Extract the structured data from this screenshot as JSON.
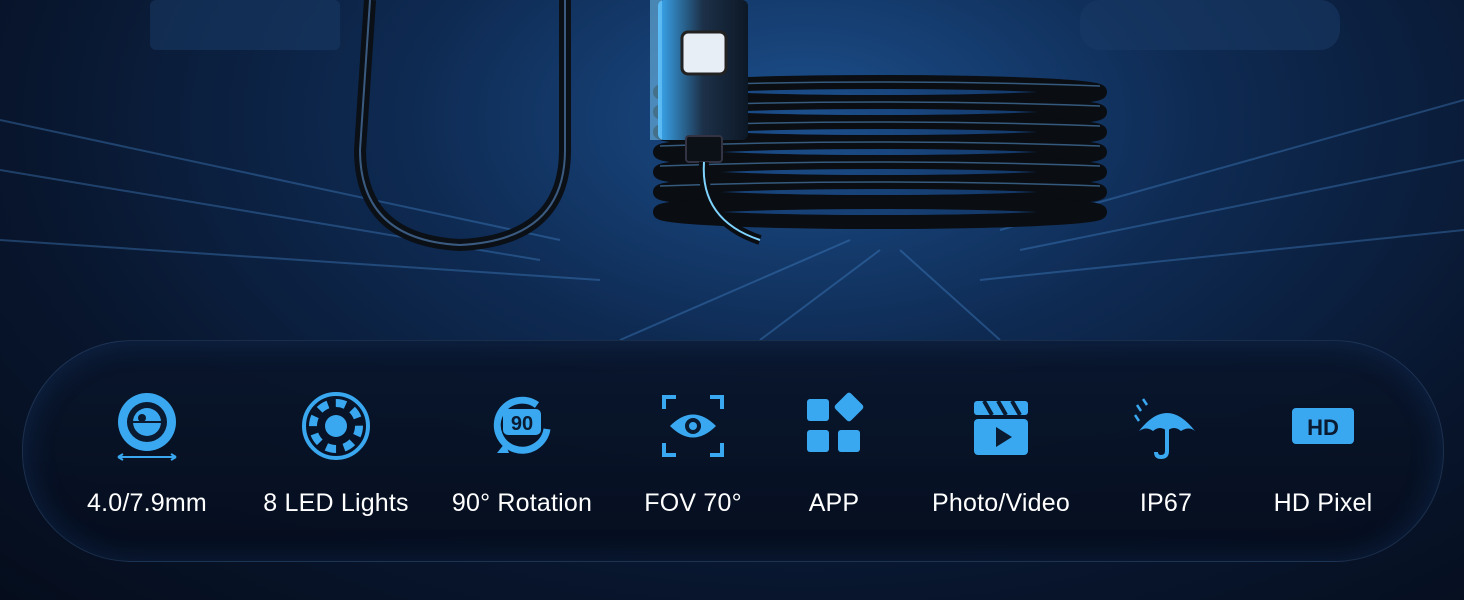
{
  "accent_color": "#3aa8f0",
  "features": [
    {
      "icon": "lens-diameter-icon",
      "label": "4.0/7.9mm"
    },
    {
      "icon": "led-ring-icon",
      "label": "8 LED Lights"
    },
    {
      "icon": "rotation-90-icon",
      "label": "90° Rotation"
    },
    {
      "icon": "eye-scan-icon",
      "label": "FOV 70°"
    },
    {
      "icon": "app-grid-icon",
      "label": "APP"
    },
    {
      "icon": "clapperboard-play-icon",
      "label": "Photo/Video"
    },
    {
      "icon": "umbrella-rain-icon",
      "label": "IP67"
    },
    {
      "icon": "hd-badge-icon",
      "label": "HD Pixel"
    }
  ]
}
